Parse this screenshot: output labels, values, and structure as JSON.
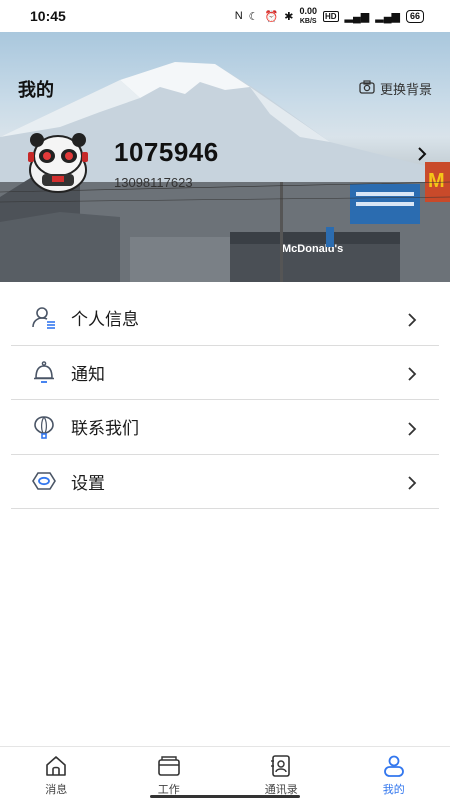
{
  "status_bar": {
    "time": "10:45",
    "net_speed": "0.00",
    "net_unit": "KB/S",
    "hd_label": "HD",
    "battery": "66"
  },
  "header": {
    "title": "我的",
    "change_background": "更换背景",
    "sign_text": "McDonald's"
  },
  "profile": {
    "username": "1075946",
    "phone": "13098117623"
  },
  "menu": {
    "items": [
      {
        "label": "个人信息",
        "icon": "person-info-icon"
      },
      {
        "label": "通知",
        "icon": "bell-icon"
      },
      {
        "label": "联系我们",
        "icon": "balloon-icon"
      },
      {
        "label": "设置",
        "icon": "settings-hexagon-icon"
      }
    ]
  },
  "tabbar": {
    "tabs": [
      {
        "label": "消息",
        "icon": "home-icon",
        "active": false
      },
      {
        "label": "工作",
        "icon": "folder-icon",
        "active": false
      },
      {
        "label": "通讯录",
        "icon": "contacts-icon",
        "active": false
      },
      {
        "label": "我的",
        "icon": "profile-icon",
        "active": true
      }
    ]
  },
  "colors": {
    "accent": "#3377ee",
    "menu_icon": "#4a5566",
    "divider": "#dcdcdc"
  }
}
